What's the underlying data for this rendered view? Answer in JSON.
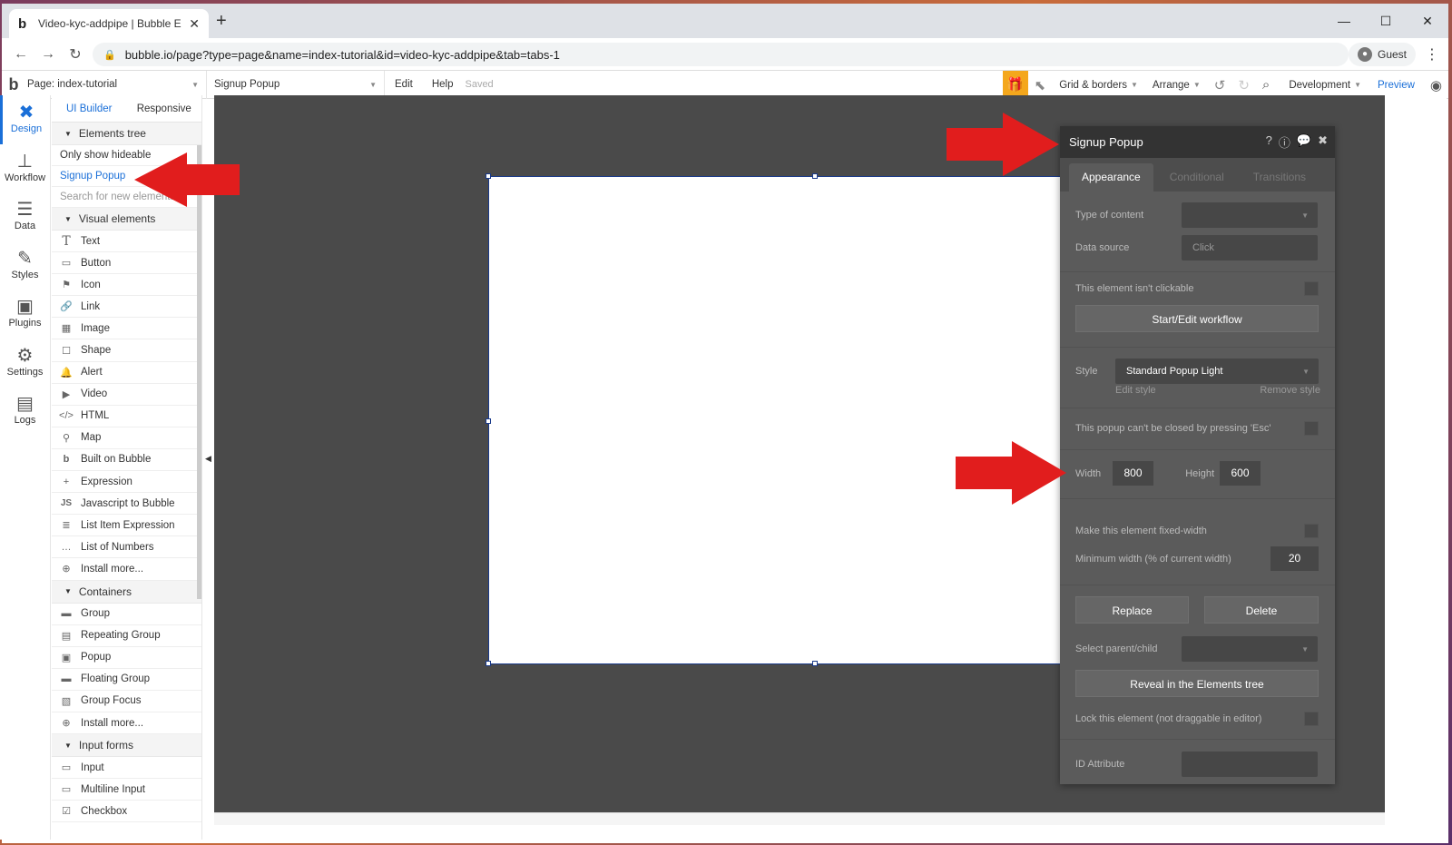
{
  "browser": {
    "tab_title": "Video-kyc-addpipe | Bubble Edit",
    "tab_favicon": "b",
    "url": "bubble.io/page?type=page&name=index-tutorial&id=video-kyc-addpipe&tab=tabs-1",
    "profile": "Guest"
  },
  "toolbar": {
    "page_select": "Page: index-tutorial",
    "element_select": "Signup Popup",
    "menu": [
      "Edit",
      "Help"
    ],
    "saved": "Saved",
    "grid": "Grid & borders",
    "arrange": "Arrange",
    "environment": "Development",
    "preview": "Preview"
  },
  "rail": [
    {
      "label": "Design",
      "icon": "design-icon"
    },
    {
      "label": "Workflow",
      "icon": "workflow-icon"
    },
    {
      "label": "Data",
      "icon": "database-icon"
    },
    {
      "label": "Styles",
      "icon": "brush-icon"
    },
    {
      "label": "Plugins",
      "icon": "plugins-icon"
    },
    {
      "label": "Settings",
      "icon": "gear-icon"
    },
    {
      "label": "Logs",
      "icon": "logs-icon"
    }
  ],
  "panel": {
    "tabs": [
      "UI Builder",
      "Responsive"
    ],
    "elements_tree": "Elements tree",
    "only_hideable": "Only show hideable",
    "selected_element": "Signup Popup",
    "search_placeholder": "Search for new elements...",
    "visual_header": "Visual elements",
    "visual": [
      "Text",
      "Button",
      "Icon",
      "Link",
      "Image",
      "Shape",
      "Alert",
      "Video",
      "HTML",
      "Map",
      "Built on Bubble",
      "Expression",
      "Javascript to Bubble",
      "List Item Expression",
      "List of Numbers",
      "Install more..."
    ],
    "containers_header": "Containers",
    "containers": [
      "Group",
      "Repeating Group",
      "Popup",
      "Floating Group",
      "Group Focus",
      "Install more..."
    ],
    "inputs_header": "Input forms",
    "inputs": [
      "Input",
      "Multiline Input",
      "Checkbox"
    ]
  },
  "property_editor": {
    "title": "Signup Popup",
    "tabs": [
      "Appearance",
      "Conditional",
      "Transitions"
    ],
    "type_of_content": "Type of content",
    "data_source": "Data source",
    "data_source_value": "Click",
    "not_clickable": "This element isn't clickable",
    "start_edit_workflow": "Start/Edit workflow",
    "style_label": "Style",
    "style_value": "Standard Popup Light",
    "edit_style": "Edit style",
    "remove_style": "Remove style",
    "esc_label": "This popup can't be closed by pressing 'Esc'",
    "width_label": "Width",
    "width_value": "800",
    "height_label": "Height",
    "height_value": "600",
    "fixed_width": "Make this element fixed-width",
    "min_width_label": "Minimum width (% of current width)",
    "min_width_value": "20",
    "replace": "Replace",
    "delete": "Delete",
    "select_parent": "Select parent/child",
    "reveal": "Reveal in the Elements tree",
    "lock": "Lock this element (not draggable in editor)",
    "id_attribute": "ID Attribute"
  },
  "colors": {
    "accent": "#1a6fd8",
    "arrow": "#e11d1d",
    "canvas": "#4a4a4a",
    "panel": "#5b5b5b"
  }
}
